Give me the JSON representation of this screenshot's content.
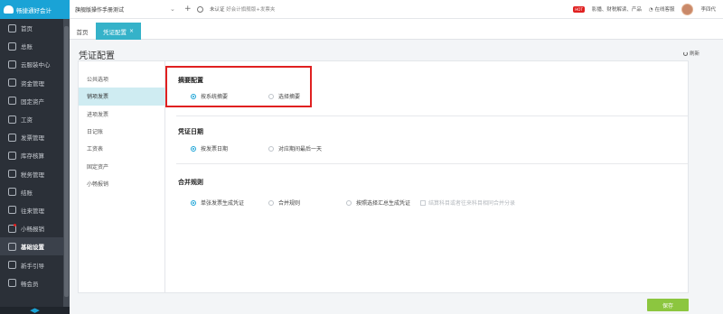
{
  "app": {
    "logo_text": "畅捷通好会计"
  },
  "sidebar": {
    "items": [
      {
        "label": "首页",
        "icon": "home-icon"
      },
      {
        "label": "总账",
        "icon": "ledger-icon"
      },
      {
        "label": "云服装中心",
        "icon": "cloud-icon"
      },
      {
        "label": "资金管理",
        "icon": "wallet-icon"
      },
      {
        "label": "固定资产",
        "icon": "asset-icon"
      },
      {
        "label": "工资",
        "icon": "salary-icon"
      },
      {
        "label": "发票管理",
        "icon": "invoice-icon"
      },
      {
        "label": "库存核算",
        "icon": "inventory-icon"
      },
      {
        "label": "税务管理",
        "icon": "tax-icon"
      },
      {
        "label": "结账",
        "icon": "close-book-icon"
      },
      {
        "label": "往来管理",
        "icon": "contacts-icon"
      },
      {
        "label": "小畅报销",
        "icon": "reimburse-icon"
      },
      {
        "label": "基础设置",
        "icon": "settings-icon"
      },
      {
        "label": "新手引导",
        "icon": "guide-icon"
      },
      {
        "label": "畅会员",
        "icon": "vip-icon"
      }
    ],
    "active_index": 12,
    "dot_index": 11
  },
  "topbar": {
    "company": "旗舰版操作手册测试",
    "status_unverified": "未认证",
    "status_text": "好会计旗舰版+发票夹",
    "hot_badge": "HOT",
    "help_text": "影播、财税解读、产品",
    "online_service": "在线客服",
    "username": "李四代"
  },
  "tabs": {
    "home": "首页",
    "active": "凭证配置",
    "close_glyph": "×"
  },
  "page": {
    "title": "凭证配置",
    "refresh_label": "刷新"
  },
  "left_nav": {
    "items": [
      "公共选项",
      "销项发票",
      "进项发票",
      "日记账",
      "工资表",
      "固定资产",
      "小畅报销"
    ],
    "active_index": 1
  },
  "sections": {
    "summary": {
      "title": "摘要配置",
      "options": [
        "按系统摘要",
        "选择摘要"
      ],
      "selected": 0
    },
    "date": {
      "title": "凭证日期",
      "options": [
        "按发票日期",
        "对应期间最后一天"
      ],
      "selected": 0
    },
    "merge": {
      "title": "合并规则",
      "options": [
        "单张发票生成凭证",
        "合并规则",
        "按照选择汇总生成凭证"
      ],
      "selected": 0,
      "checkbox_label": "结算科目或者往来科目相同合并分录"
    }
  },
  "buttons": {
    "save": "保存"
  },
  "colors": {
    "accent": "#1aa3d6",
    "tab_active": "#35b2c9",
    "save": "#8cc63f",
    "highlight": "#e02020",
    "sidebar": "#2b3038"
  }
}
